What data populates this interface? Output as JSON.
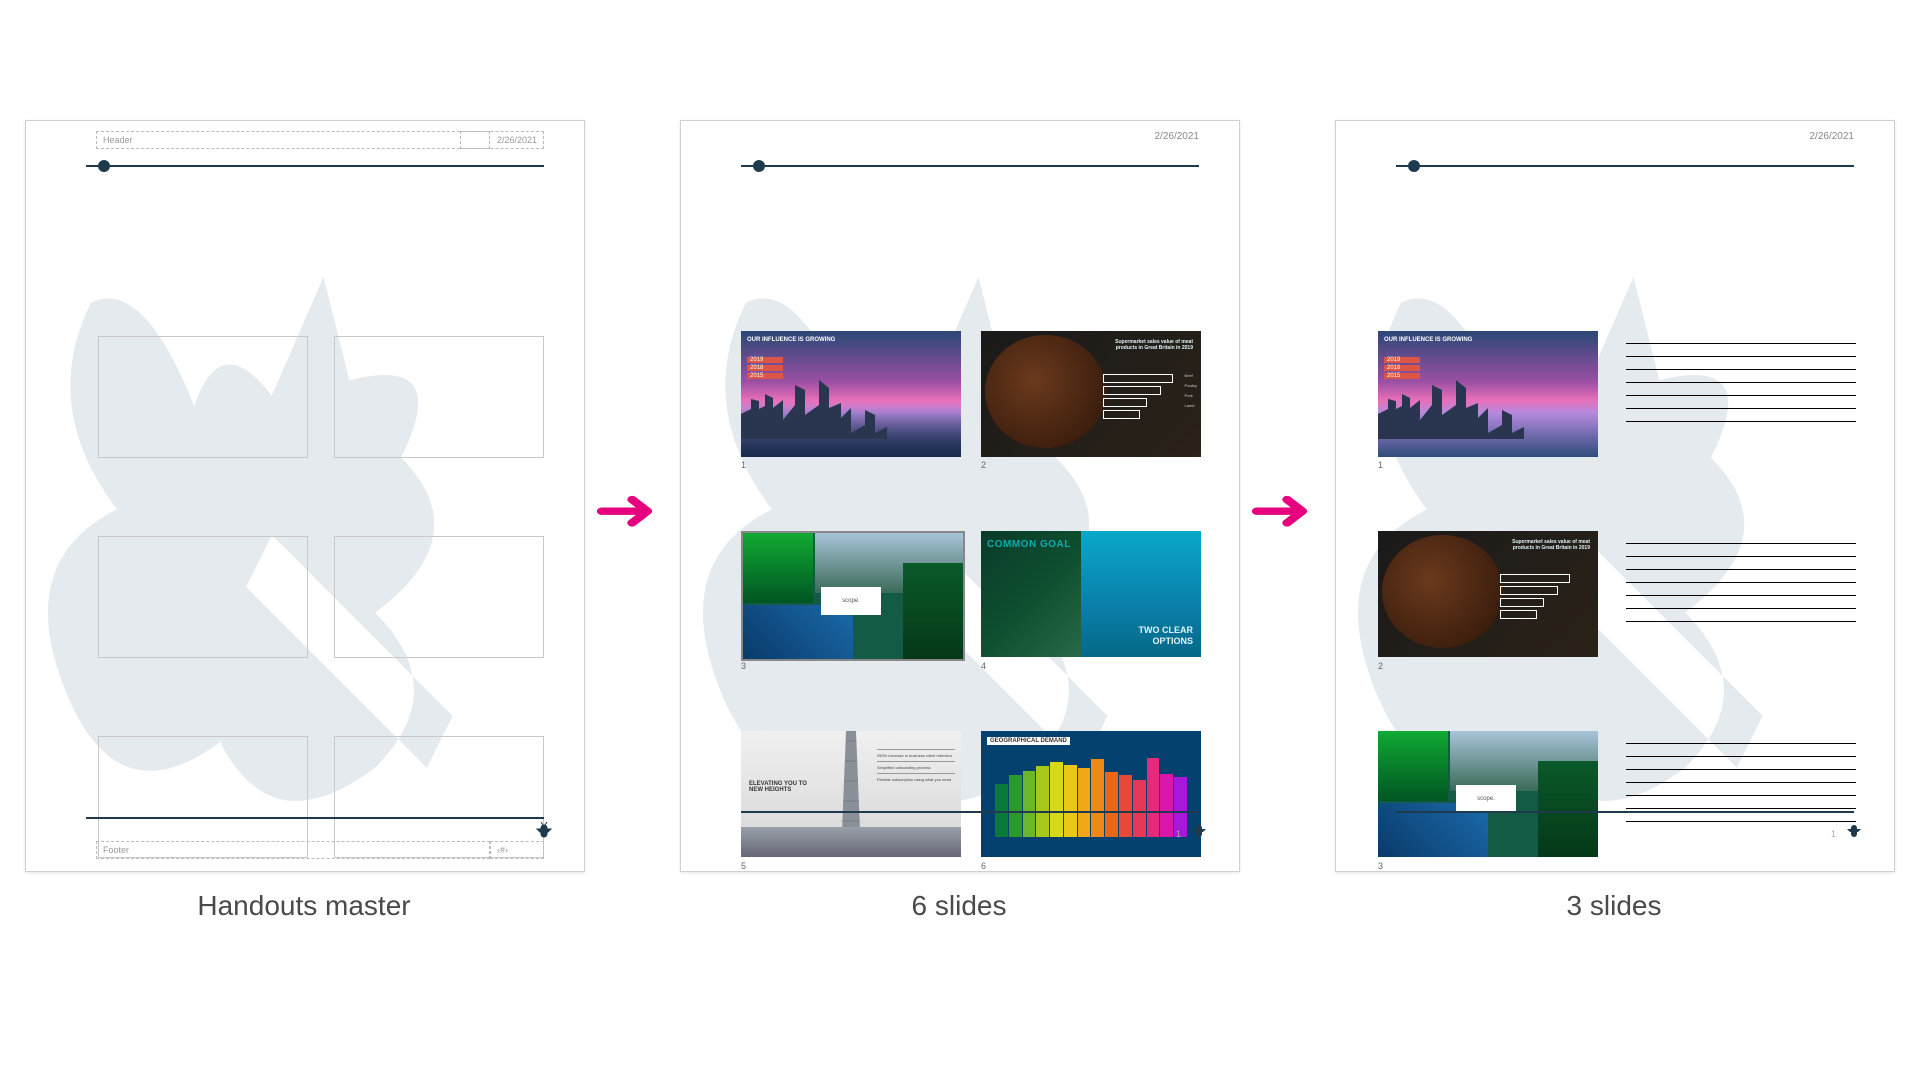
{
  "date": "2/26/2021",
  "labels": {
    "master": "Handouts master",
    "six": "6 slides",
    "three": "3 slides"
  },
  "master": {
    "header_ph": "Header",
    "footer_ph": "Footer"
  },
  "page_number": "1",
  "slides": {
    "1": {
      "num": "1",
      "title": "OUR INFLUENCE IS GROWING",
      "rows": [
        "2019",
        "2018",
        "2015"
      ]
    },
    "2": {
      "num": "2",
      "title": "Supermarket sales value of meat products in Great Britain in 2019",
      "legend": [
        "Beef",
        "Poultry",
        "Pork",
        "Lamb"
      ]
    },
    "3": {
      "num": "3",
      "caption": "scope."
    },
    "4": {
      "num": "4",
      "title": "COMMON GOAL",
      "sub": "TWO CLEAR OPTIONS"
    },
    "5": {
      "num": "5",
      "title": "ELEVATING YOU TO NEW HEIGHTS",
      "bullets": [
        "250% Increase in business client retention",
        "Simplified onboarding process",
        "Flexible subscription using what you need"
      ]
    },
    "6": {
      "num": "6",
      "title": "GEOGRAPHICAL DEMAND"
    }
  }
}
